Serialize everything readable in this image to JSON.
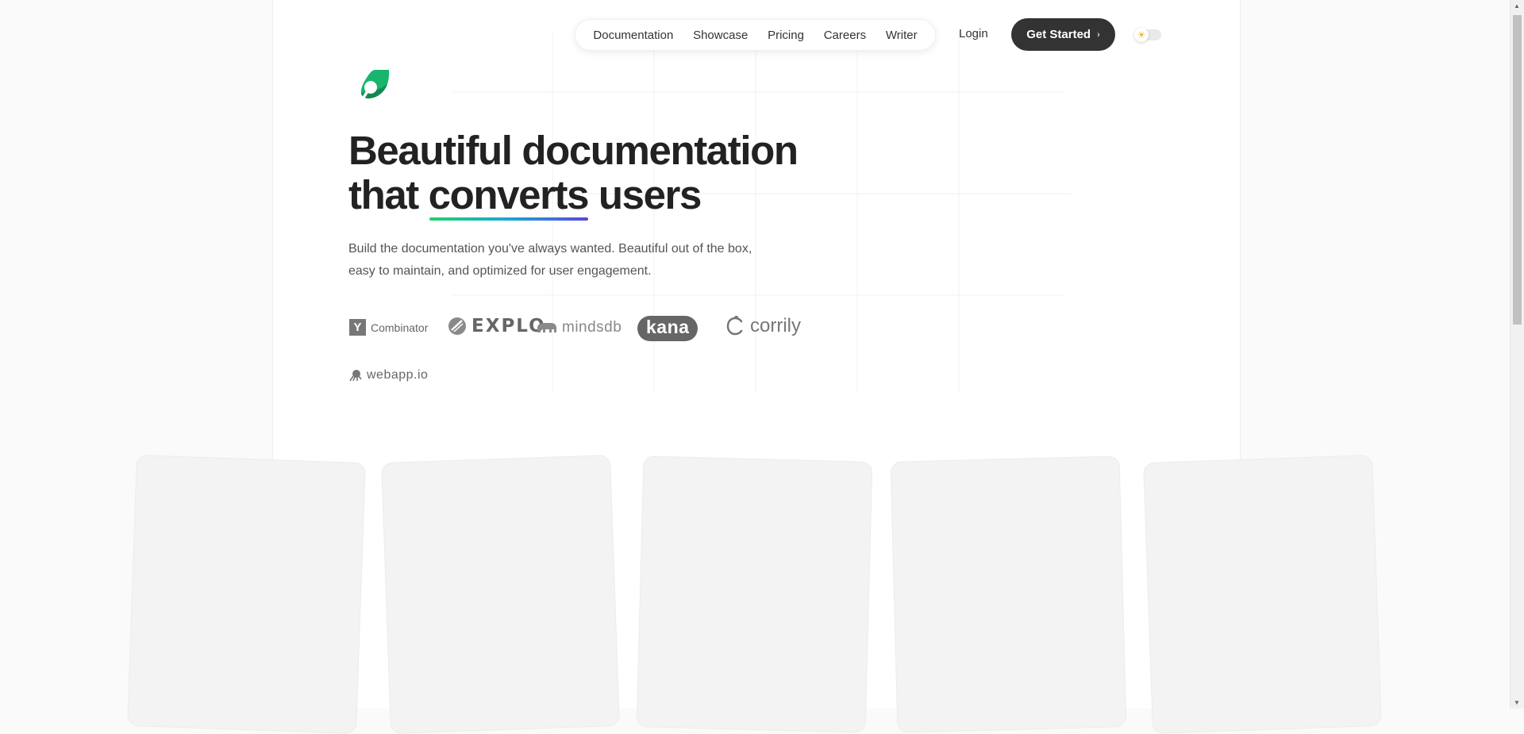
{
  "nav": {
    "links": [
      "Documentation",
      "Showcase",
      "Pricing",
      "Careers",
      "Writer"
    ],
    "login_label": "Login",
    "cta_label": "Get Started",
    "cta_chevron": "›"
  },
  "hero": {
    "headline_line1": "Beautiful documentation",
    "headline_line2_prefix": "that",
    "headline_highlight": "converts",
    "headline_line2_suffix": "users",
    "subtitle_line1": "Build the documentation you've always wanted. Beautiful out of the box,",
    "subtitle_line2": "easy to maintain, and optimized for user engagement."
  },
  "logos": {
    "ycombinator_mark": "Y",
    "ycombinator_text": "Combinator",
    "explo": "EXPLO",
    "mindsdb": "mindsdb",
    "kana": "kana",
    "corrily": "corrily",
    "webapp": "webapp.io"
  },
  "colors": {
    "accent_green": "#16a864",
    "cta_background": "#333333",
    "underline_gradient": [
      "#1fd36a",
      "#1aa6d6",
      "#5b46d8"
    ]
  },
  "icons": {
    "theme_toggle": "sun-icon",
    "logo": "leaf-logo-icon"
  },
  "cards": [
    "",
    "",
    "",
    "",
    ""
  ]
}
